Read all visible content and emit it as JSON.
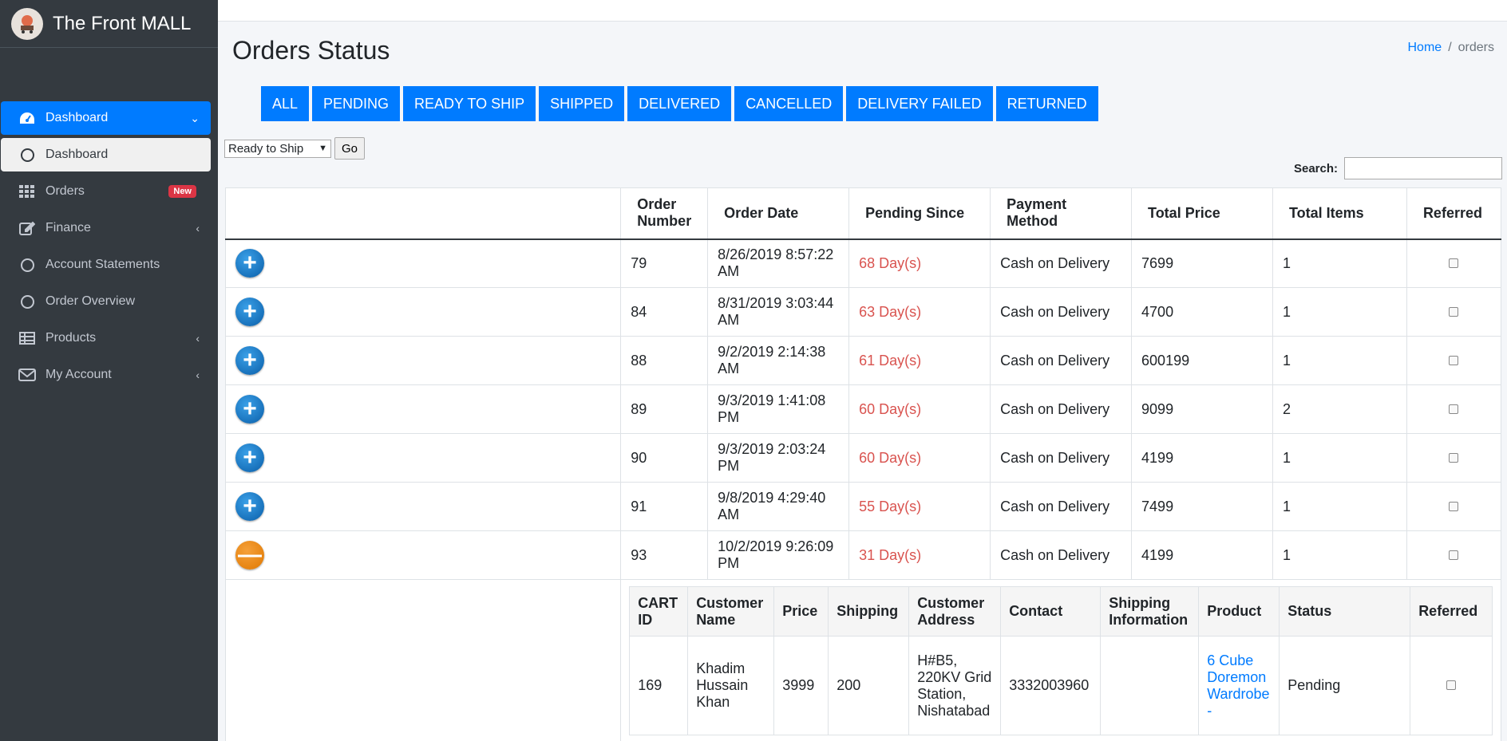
{
  "brand": {
    "name": "The Front MALL",
    "logo_icon": "cart-logo-icon"
  },
  "sidebar": {
    "items": [
      {
        "label": "Dashboard",
        "icon": "dashboard-icon",
        "state": "active"
      },
      {
        "label": "Dashboard",
        "icon": "circle-icon",
        "state": "sub-active"
      },
      {
        "label": "Orders",
        "icon": "grid-icon",
        "badge": "New"
      },
      {
        "label": "Finance",
        "icon": "edit-icon"
      },
      {
        "label": "Account Statements",
        "icon": "circle-icon"
      },
      {
        "label": "Order Overview",
        "icon": "circle-icon"
      },
      {
        "label": "Products",
        "icon": "table-icon"
      },
      {
        "label": "My Account",
        "icon": "envelope-icon"
      }
    ]
  },
  "page": {
    "title": "Orders Status"
  },
  "breadcrumb": {
    "home": "Home",
    "separator": "/",
    "current": "orders"
  },
  "filters": [
    "ALL",
    "PENDING",
    "READY TO SHIP",
    "SHIPPED",
    "DELIVERED",
    "CANCELLED",
    "DELIVERY FAILED",
    "RETURNED"
  ],
  "status_select": {
    "value": "Ready to Ship",
    "go_label": "Go"
  },
  "search": {
    "label": "Search:"
  },
  "table": {
    "headers": [
      "Order Number",
      "Order Date",
      "Pending Since",
      "Payment Method",
      "Total Price",
      "Total Items",
      "Referred"
    ],
    "rows": [
      {
        "order": "79",
        "date": "8/26/2019 8:57:22 AM",
        "pending": "68 Day(s)",
        "payment": "Cash on Delivery",
        "price": "7699",
        "items": "1",
        "expanded": false
      },
      {
        "order": "84",
        "date": "8/31/2019 3:03:44 AM",
        "pending": "63 Day(s)",
        "payment": "Cash on Delivery",
        "price": "4700",
        "items": "1",
        "expanded": false
      },
      {
        "order": "88",
        "date": "9/2/2019 2:14:38 AM",
        "pending": "61 Day(s)",
        "payment": "Cash on Delivery",
        "price": "600199",
        "items": "1",
        "expanded": false
      },
      {
        "order": "89",
        "date": "9/3/2019 1:41:08 PM",
        "pending": "60 Day(s)",
        "payment": "Cash on Delivery",
        "price": "9099",
        "items": "2",
        "expanded": false
      },
      {
        "order": "90",
        "date": "9/3/2019 2:03:24 PM",
        "pending": "60 Day(s)",
        "payment": "Cash on Delivery",
        "price": "4199",
        "items": "1",
        "expanded": false
      },
      {
        "order": "91",
        "date": "9/8/2019 4:29:40 AM",
        "pending": "55 Day(s)",
        "payment": "Cash on Delivery",
        "price": "7499",
        "items": "1",
        "expanded": false
      },
      {
        "order": "93",
        "date": "10/2/2019 9:26:09 PM",
        "pending": "31 Day(s)",
        "payment": "Cash on Delivery",
        "price": "4199",
        "items": "1",
        "expanded": true
      }
    ]
  },
  "detail": {
    "headers": [
      "CART ID",
      "Customer Name",
      "Price",
      "Shipping",
      "Customer Address",
      "Contact",
      "Shipping Information",
      "Product",
      "Status",
      "Referred"
    ],
    "row": {
      "cart_id": "169",
      "customer": "Khadim Hussain Khan",
      "price": "3999",
      "shipping": "200",
      "address": "H#B5, 220KV Grid Station, Nishatabad",
      "contact": "3332003960",
      "shipping_info": "",
      "product": "6 Cube Doremon Wardrobe -",
      "status": "Pending"
    }
  },
  "colors": {
    "sidebar_bg": "#343a40",
    "accent": "#007bff",
    "pending_text": "#d9534f",
    "badge": "#dc3545"
  }
}
